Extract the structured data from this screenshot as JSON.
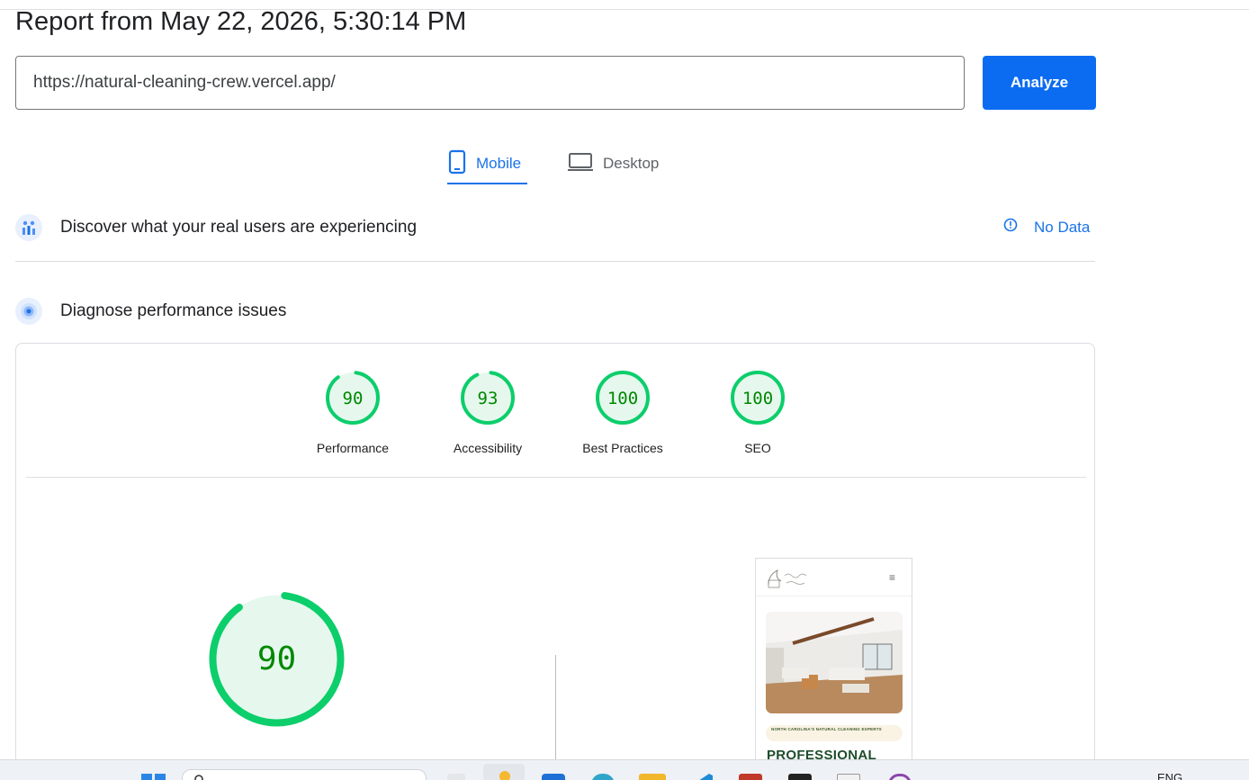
{
  "header": {
    "report_title": "Report from May 22, 2026, 5:30:14 PM"
  },
  "url_bar": {
    "value": "https://natural-cleaning-crew.vercel.app/",
    "analyze_label": "Analyze"
  },
  "tabs": [
    {
      "label": "Mobile",
      "active": true
    },
    {
      "label": "Desktop",
      "active": false
    }
  ],
  "field_data": {
    "title": "Discover what your real users are experiencing",
    "status": "No Data"
  },
  "lab_data": {
    "title": "Diagnose performance issues",
    "scores": [
      {
        "label": "Performance",
        "value": "90",
        "score": 0.9
      },
      {
        "label": "Accessibility",
        "value": "93",
        "score": 0.93
      },
      {
        "label": "Best Practices",
        "value": "100",
        "score": 1.0
      },
      {
        "label": "SEO",
        "value": "100",
        "score": 1.0
      }
    ],
    "main_score": {
      "value": "90",
      "score": 0.9
    }
  },
  "screenshot_preview": {
    "badge": "NORTH CAROLINA'S NATURAL CLEANING EXPERTS",
    "heading": "PROFESSIONAL",
    "menu_icon": "≡"
  },
  "taskbar": {
    "lang": "ENG"
  },
  "colors": {
    "accent": "#1a73e8",
    "button": "#0b6cf2",
    "score_pass": "#0cce6b",
    "score_text": "#008800",
    "score_fill": "#e6f8ee"
  }
}
